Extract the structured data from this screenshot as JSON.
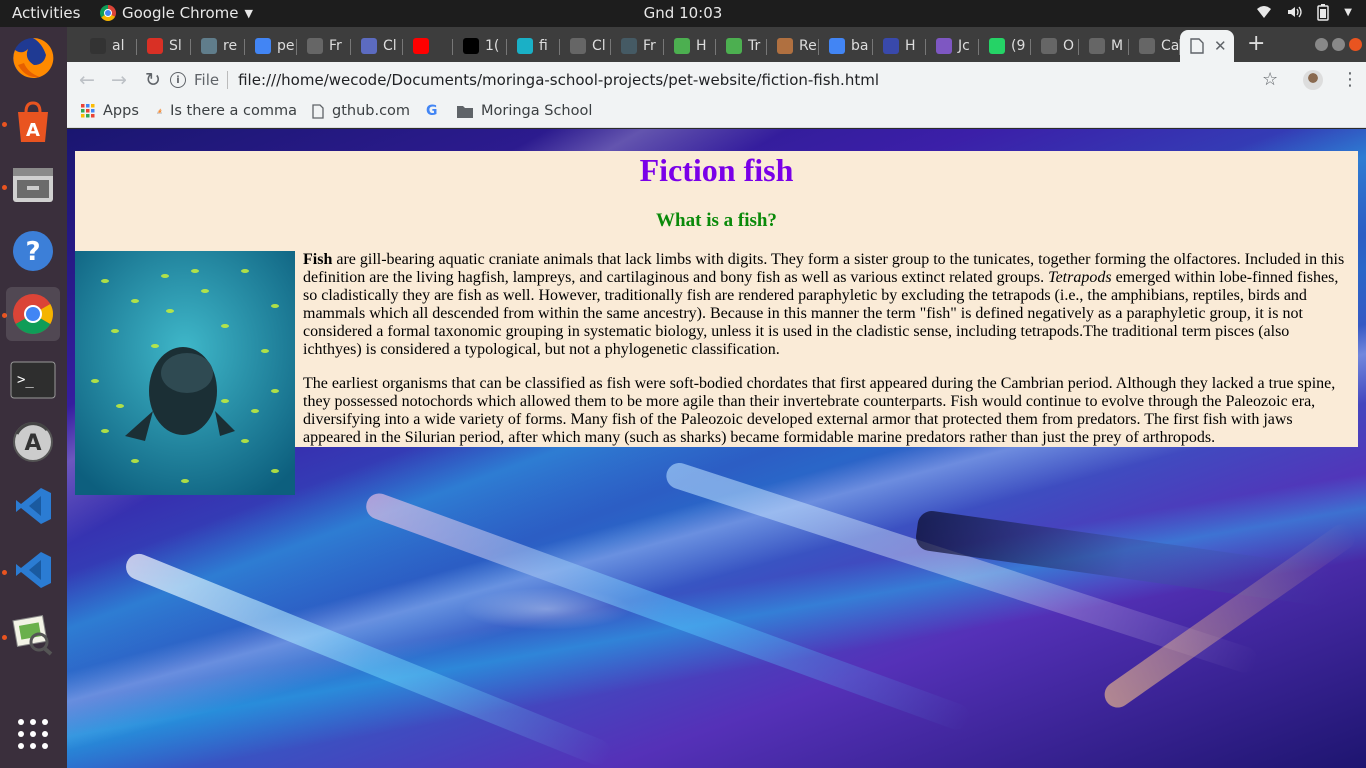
{
  "system": {
    "activities": "Activities",
    "app_name": "Google Chrome",
    "clock": "Gnd 10:03"
  },
  "dock": {
    "items": [
      "firefox-icon",
      "software-center-icon",
      "files-icon",
      "help-icon",
      "chrome-icon",
      "terminal-icon",
      "software-updater-icon",
      "vscode-icon",
      "vscode-icon-2",
      "image-viewer-icon",
      "show-apps-icon"
    ]
  },
  "tabs": [
    {
      "title": "al",
      "icon": "github-icon",
      "color": "#333333"
    },
    {
      "title": "Sl",
      "icon": "gmail-icon",
      "color": "#d93025"
    },
    {
      "title": "re",
      "icon": "spiral-icon",
      "color": "#607d8b"
    },
    {
      "title": "pe",
      "icon": "google-icon",
      "color": "#4285f4"
    },
    {
      "title": "Fr",
      "icon": "generic-icon",
      "color": "#666666"
    },
    {
      "title": "Cl",
      "icon": "question-icon",
      "color": "#5c6bc0"
    },
    {
      "title": "",
      "icon": "youtube-icon",
      "color": "#ff0000"
    },
    {
      "title": "1(",
      "icon": "medium-icon",
      "color": "#000000"
    },
    {
      "title": "fi",
      "icon": "generic-teal-icon",
      "color": "#1ab0c6"
    },
    {
      "title": "Cl",
      "icon": "generic-icon",
      "color": "#666666"
    },
    {
      "title": "Fr",
      "icon": "list-icon",
      "color": "#455a64"
    },
    {
      "title": "H",
      "icon": "w3-icon",
      "color": "#4caf50"
    },
    {
      "title": "Tr",
      "icon": "w3-icon",
      "color": "#4caf50"
    },
    {
      "title": "Re",
      "icon": "box-icon",
      "color": "#b07040"
    },
    {
      "title": "ba",
      "icon": "google-icon",
      "color": "#4285f4"
    },
    {
      "title": "H",
      "icon": "h-icon",
      "color": "#3949ab"
    },
    {
      "title": "Jc",
      "icon": "gear-icon",
      "color": "#7e57c2"
    },
    {
      "title": "(9",
      "icon": "whatsapp-icon",
      "color": "#25d366"
    },
    {
      "title": "O",
      "icon": "generic-icon",
      "color": "#666666"
    },
    {
      "title": "M",
      "icon": "generic-icon",
      "color": "#666666"
    },
    {
      "title": "Ca",
      "icon": "generic-icon",
      "color": "#666666"
    }
  ],
  "new_tab_label": "+",
  "address_bar": {
    "scheme_label": "File",
    "url": "file:///home/wecode/Documents/moringa-school-projects/pet-website/fiction-fish.html"
  },
  "bookmarks": [
    {
      "label": "Apps",
      "icon": "apps-grid-icon"
    },
    {
      "label": "Is there a comma",
      "icon": "stackoverflow-icon"
    },
    {
      "label": "gthub.com",
      "icon": "page-icon"
    },
    {
      "label": "",
      "icon": "google-icon"
    },
    {
      "label": "Moringa School",
      "icon": "folder-icon"
    }
  ],
  "page": {
    "title": "Fiction fish",
    "subtitle": "What is a fish?",
    "p1_bold": "Fish",
    "p1_part1": " are gill-bearing aquatic craniate animals that lack limbs with digits. They form a sister group to the tunicates, together forming the olfactores. Included in this definition are the living hagfish, lampreys, and cartilaginous and bony fish as well as various extinct related groups. ",
    "p1_italic": "Tetrapods",
    "p1_part2": " emerged within lobe-finned fishes, so cladistically they are fish as well. However, traditionally fish are rendered paraphyletic by excluding the tetrapods (i.e., the amphibians, reptiles, birds and mammals which all descended from within the same ancestry). Because in this manner the term \"fish\" is defined negatively as a paraphyletic group, it is not considered a formal taxonomic grouping in systematic biology, unless it is used in the cladistic sense, including tetrapods.The traditional term pisces (also ichthyes) is considered a typological, but not a phylogenetic classification.",
    "p2": "The earliest organisms that can be classified as fish were soft-bodied chordates that first appeared during the Cambrian period. Although they lacked a true spine, they possessed notochords which allowed them to be more agile than their invertebrate counterparts. Fish would continue to evolve through the Paleozoic era, diversifying into a wide variety of forms. Many fish of the Paleozoic developed external armor that protected them from predators. The first fish with jaws appeared in the Silurian period, after which many (such as sharks) became formidable marine predators rather than just the prey of arthropods."
  }
}
